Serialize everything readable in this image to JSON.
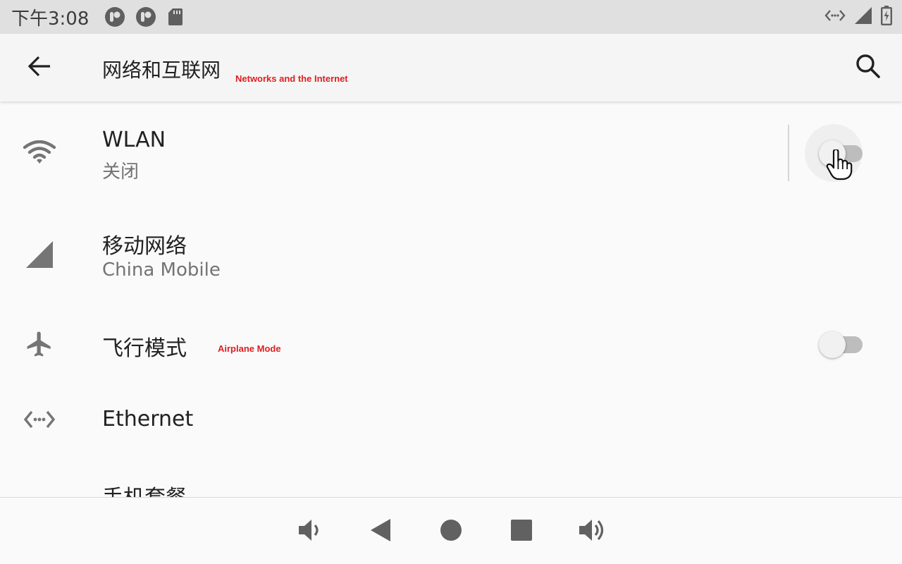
{
  "status_bar": {
    "time": "下午3:08",
    "left_icons": [
      "app-notification-icon",
      "app-notification-icon",
      "sd-card-icon"
    ],
    "right_icons": [
      "ethernet-icon",
      "cellular-signal-icon",
      "battery-charging-icon"
    ]
  },
  "app_bar": {
    "title": "网络和互联网",
    "annotation": "Networks and the Internet",
    "back_icon": "arrow-back-icon",
    "search_icon": "search-icon"
  },
  "settings": {
    "items": [
      {
        "icon": "wifi-icon",
        "title": "WLAN",
        "subtitle": "关闭",
        "toggle": "off"
      },
      {
        "icon": "cellular-signal-icon",
        "title": "移动网络",
        "subtitle": "China Mobile"
      },
      {
        "icon": "airplane-icon",
        "title": "飞行模式",
        "annotation": "Airplane Mode",
        "toggle": "off"
      },
      {
        "icon": "ethernet-icon",
        "title": "Ethernet"
      },
      {
        "icon": "",
        "title": "手机套餐"
      }
    ]
  },
  "nav_bar": {
    "buttons": [
      "volume-down-icon",
      "back-triangle-icon",
      "home-circle-icon",
      "recents-square-icon",
      "volume-up-icon"
    ]
  },
  "colors": {
    "status_bar_bg": "#e0e0e0",
    "app_bar_bg": "#f5f5f5",
    "background": "#fafafa",
    "annotation_red": "#e01e1e",
    "icon_gray": "#757575",
    "switch_track_off": "#bdbdbd"
  }
}
